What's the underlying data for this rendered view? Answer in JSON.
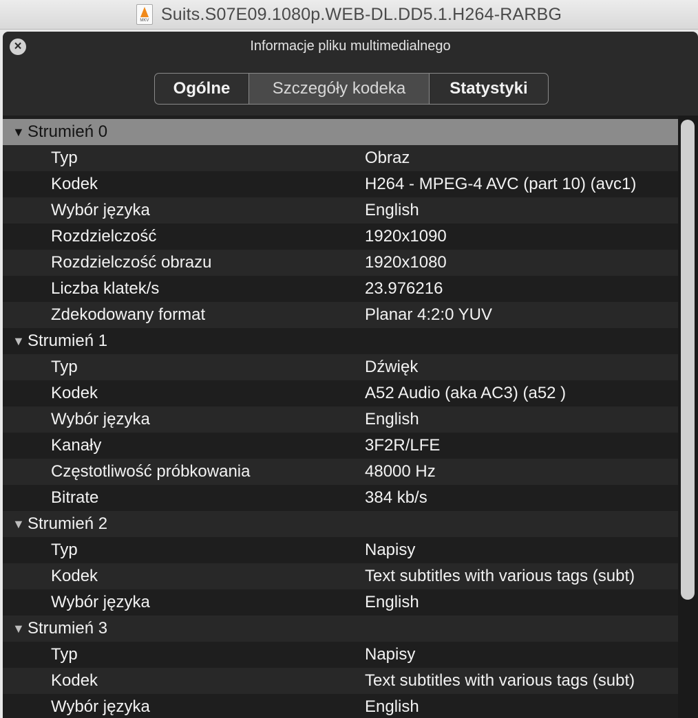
{
  "window": {
    "title": "Suits.S07E09.1080p.WEB-DL.DD5.1.H264-RARBG",
    "file_icon": "vlc-cone-document-icon",
    "file_icon_label": "MKV"
  },
  "panel": {
    "title": "Informacje pliku multimedialnego",
    "close_icon": "close-icon"
  },
  "tabs": [
    {
      "label": "Ogólne",
      "selected": false
    },
    {
      "label": "Szczegóły kodeka",
      "selected": true
    },
    {
      "label": "Statystyki",
      "selected": false
    }
  ],
  "streams": [
    {
      "label": "Strumień 0",
      "properties": [
        {
          "key": "Typ",
          "value": "Obraz"
        },
        {
          "key": "Kodek",
          "value": "H264 - MPEG-4 AVC (part 10) (avc1)"
        },
        {
          "key": "Wybór języka",
          "value": "English"
        },
        {
          "key": "Rozdzielczość",
          "value": "1920x1090"
        },
        {
          "key": "Rozdzielczość obrazu",
          "value": "1920x1080"
        },
        {
          "key": "Liczba klatek/s",
          "value": "23.976216"
        },
        {
          "key": "Zdekodowany format",
          "value": "Planar 4:2:0 YUV"
        }
      ]
    },
    {
      "label": "Strumień 1",
      "properties": [
        {
          "key": "Typ",
          "value": "Dźwięk"
        },
        {
          "key": "Kodek",
          "value": "A52 Audio (aka AC3) (a52 )"
        },
        {
          "key": "Wybór języka",
          "value": "English"
        },
        {
          "key": "Kanały",
          "value": "3F2R/LFE"
        },
        {
          "key": "Częstotliwość próbkowania",
          "value": "48000 Hz"
        },
        {
          "key": "Bitrate",
          "value": "384 kb/s"
        }
      ]
    },
    {
      "label": "Strumień 2",
      "properties": [
        {
          "key": "Typ",
          "value": "Napisy"
        },
        {
          "key": "Kodek",
          "value": "Text subtitles with various tags (subt)"
        },
        {
          "key": "Wybór języka",
          "value": "English"
        }
      ]
    },
    {
      "label": "Strumień 3",
      "properties": [
        {
          "key": "Typ",
          "value": "Napisy"
        },
        {
          "key": "Kodek",
          "value": "Text subtitles with various tags (subt)"
        },
        {
          "key": "Wybór języka",
          "value": "English"
        }
      ]
    }
  ],
  "colors": {
    "panel_bg": "#2a2a2a",
    "list_bg": "#1e1e1e",
    "selected_row": "#8b8b8b",
    "text": "#f2f2f2"
  }
}
